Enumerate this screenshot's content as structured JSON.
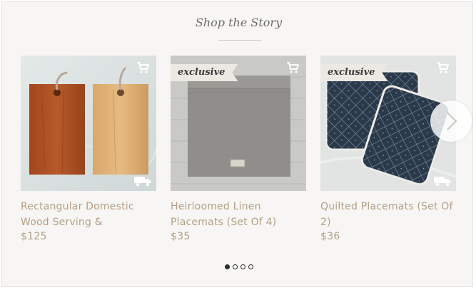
{
  "section": {
    "title": "Shop the Story"
  },
  "products": [
    {
      "name": "Rectangular Domestic Wood Serving &",
      "price": "$125",
      "badge": "",
      "cart_icon": "cart-icon",
      "shipping_icon": "shipping-truck-icon"
    },
    {
      "name": "Heirloomed Linen Placemats (Set Of 4)",
      "price": "$35",
      "badge": "exclusive",
      "cart_icon": "cart-icon",
      "shipping_icon": ""
    },
    {
      "name": "Quilted Placemats (Set Of 2)",
      "price": "$36",
      "badge": "exclusive",
      "cart_icon": "cart-icon",
      "shipping_icon": "shipping-truck-icon"
    }
  ],
  "carousel": {
    "next_icon": "chevron-right-icon",
    "pages": 4,
    "active_page": 1
  },
  "colors": {
    "text_tan": "#b49f86",
    "background": "#f7f6f4",
    "title_gray": "#6b6b6b"
  }
}
